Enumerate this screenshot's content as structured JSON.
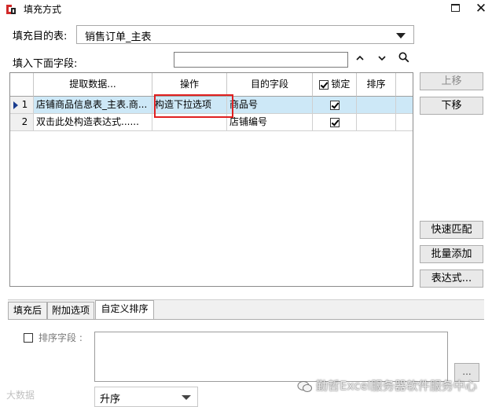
{
  "window": {
    "title": "填充方式"
  },
  "target": {
    "label": "填充目的表:",
    "value": "销售订单_主表"
  },
  "fields": {
    "label": "填入下面字段:",
    "search_value": ""
  },
  "grid": {
    "headers": [
      "提取数据...",
      "操作",
      "目的字段",
      "锁定",
      "排序"
    ],
    "lock_header_checked": true,
    "rows": [
      {
        "num": "1",
        "source": "店铺商品信息表_主表.商...",
        "op": "构造下拉选项",
        "target": "商品号",
        "locked": true,
        "sort": ""
      },
      {
        "num": "2",
        "source": "双击此处构造表达式......",
        "op": "",
        "target": "店铺编号",
        "locked": true,
        "sort": ""
      }
    ]
  },
  "buttons": {
    "up": "上移",
    "down": "下移",
    "quick_match": "快速匹配",
    "batch_add": "批量添加",
    "expression": "表达式..."
  },
  "tabs": [
    "填充后",
    "附加选项",
    "自定义排序"
  ],
  "sort": {
    "field_label": "排序字段 :",
    "ellipsis": "...",
    "order_value": "升序"
  },
  "watermark": {
    "left": "大数据",
    "right": "勤哲Excel服务器软件服务中心"
  }
}
